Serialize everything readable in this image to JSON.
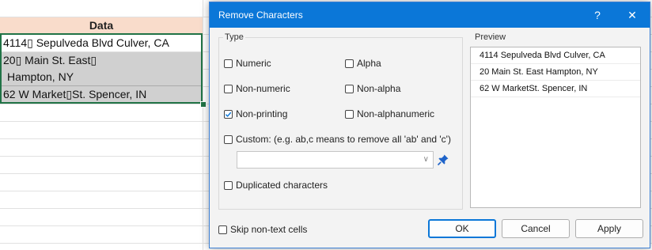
{
  "sheet": {
    "header": "Data",
    "rows": [
      "4114▯ Sepulveda Blvd Culver, CA",
      "20▯ Main St. East▯",
      "Hampton, NY",
      "62 W Market▯St. Spencer, IN"
    ]
  },
  "dialog": {
    "title": "Remove Characters",
    "help": "?",
    "close": "✕",
    "type_label": "Type",
    "options": {
      "numeric": "Numeric",
      "alpha": "Alpha",
      "non_numeric": "Non-numeric",
      "non_alpha": "Non-alpha",
      "non_printing": "Non-printing",
      "non_alphanumeric": "Non-alphanumeric",
      "custom": "Custom:  (e.g. ab,c means to remove all 'ab' and 'c')",
      "duplicated": "Duplicated characters"
    },
    "checked": {
      "non_printing": true
    },
    "custom_value": "",
    "preview_label": "Preview",
    "preview_rows": [
      "4114 Sepulveda Blvd Culver, CA",
      "20 Main St. East Hampton, NY",
      "62 W MarketSt. Spencer, IN"
    ],
    "skip_label": "Skip non-text cells",
    "buttons": {
      "ok": "OK",
      "cancel": "Cancel",
      "apply": "Apply"
    }
  },
  "colors": {
    "accent": "#0b77d8",
    "selection_border": "#217346",
    "header_fill": "#f9dccb"
  },
  "icons": {
    "pin": "pin-icon",
    "dropdown": "chevron-down-icon"
  }
}
